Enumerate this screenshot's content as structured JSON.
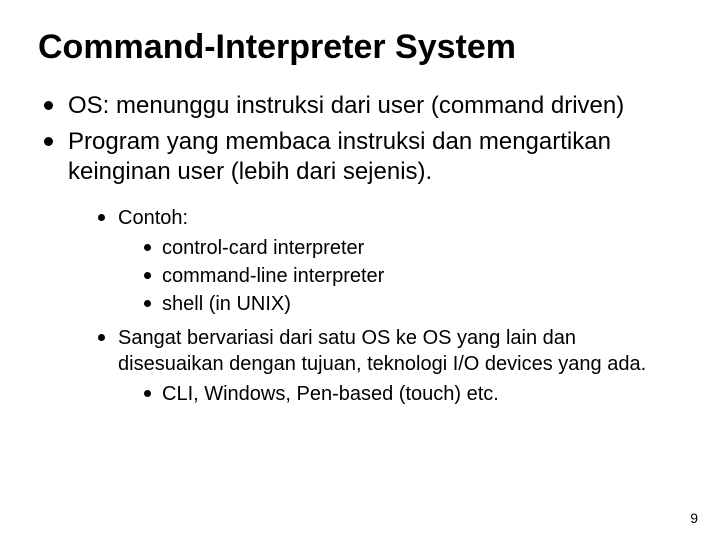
{
  "title": "Command-Interpreter System",
  "bullets": {
    "l1_0": "OS: menunggu instruksi dari user (command driven)",
    "l1_1": "Program yang membaca instruksi dan mengartikan keinginan user (lebih dari sejenis).",
    "l2_0": "Contoh:",
    "l3_0": "control-card interpreter",
    "l3_1": "command-line interpreter",
    "l3_2": "shell (in UNIX)",
    "l2_1": "Sangat bervariasi dari satu OS ke OS yang lain dan disesuaikan dengan tujuan, teknologi I/O devices yang ada.",
    "l4_0": "CLI, Windows, Pen-based (touch) etc."
  },
  "page_number": "9"
}
